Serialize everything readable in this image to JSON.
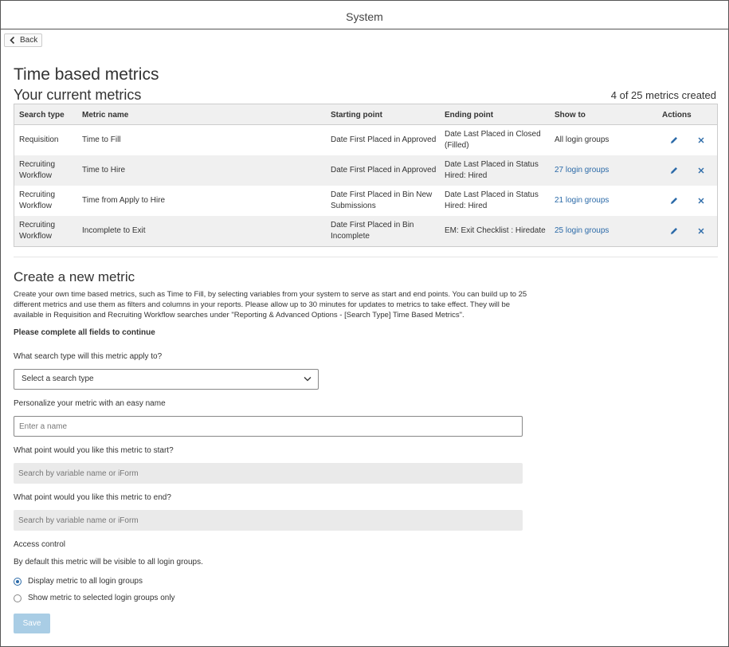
{
  "topbar": {
    "title": "System"
  },
  "back_button": {
    "label": "Back"
  },
  "page": {
    "title": "Time based metrics",
    "current_heading": "Your current metrics",
    "count_text": "4 of 25 metrics created"
  },
  "table": {
    "headers": [
      "Search type",
      "Metric name",
      "Starting point",
      "Ending point",
      "Show to",
      "Actions"
    ],
    "rows": [
      {
        "search_type": "Requisition",
        "metric_name": "Time to Fill",
        "start": "Date First Placed in Approved",
        "end": "Date Last Placed in Closed (Filled)",
        "show_to": "All login groups"
      },
      {
        "search_type": "Recruiting Workflow",
        "metric_name": "Time to Hire",
        "start": "Date First Placed in Approved",
        "end": "Date Last Placed in Status Hired: Hired",
        "show_to": "27 login groups"
      },
      {
        "search_type": "Recruiting Workflow",
        "metric_name": "Time from Apply to Hire",
        "start": "Date First Placed in Bin New Submissions",
        "end": "Date Last Placed in Status Hired: Hired",
        "show_to": "21 login groups"
      },
      {
        "search_type": "Recruiting Workflow",
        "metric_name": "Incomplete to Exit",
        "start": "Date First Placed in Bin Incomplete",
        "end": "EM: Exit Checklist : Hiredate",
        "show_to": "25 login groups"
      }
    ]
  },
  "create": {
    "heading": "Create a new metric",
    "description": "Create your own time based metrics, such as Time to Fill, by selecting variables from your system to serve as start and end points. You can build up to 25 different metrics and use them as filters and columns in your reports. Please allow up to 30 minutes for updates to metrics to take effect. They will be available in Requisition and Recruiting Workflow searches under \"Reporting & Advanced Options - [Search Type] Time Based Metrics\".",
    "required_note": "Please complete all fields to continue",
    "search_type_label": "What search type will this metric apply to?",
    "search_type_value": "Select a search type",
    "name_label": "Personalize your metric with an easy name",
    "name_placeholder": "Enter a name",
    "start_label": "What point would you like this metric to start?",
    "start_placeholder": "Search by variable name or iForm",
    "end_label": "What point would you like this metric to end?",
    "end_placeholder": "Search by variable name or iForm",
    "access_label": "Access control",
    "access_note": "By default this metric will be visible to all login groups.",
    "radio_all": "Display metric to all login groups",
    "radio_selected": "Show metric to selected login groups only",
    "save_label": "Save"
  },
  "colors": {
    "link": "#2b6aa8",
    "save_disabled": "#a9cde5"
  },
  "icons": {
    "edit": "pencil-icon",
    "delete": "close-icon",
    "back": "chevron-left-icon",
    "select": "chevron-down-icon"
  }
}
